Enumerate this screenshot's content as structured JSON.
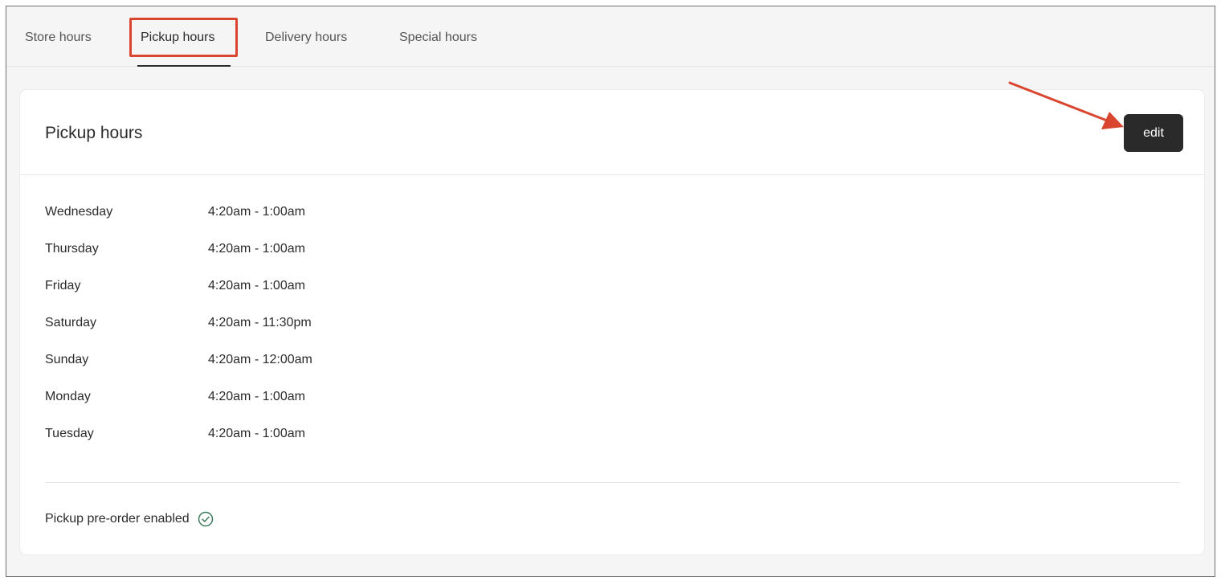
{
  "tabs": [
    {
      "label": "Store hours",
      "active": false
    },
    {
      "label": "Pickup hours",
      "active": true
    },
    {
      "label": "Delivery hours",
      "active": false
    },
    {
      "label": "Special hours",
      "active": false
    }
  ],
  "card": {
    "title": "Pickup hours",
    "edit_label": "edit"
  },
  "hours": [
    {
      "day": "Wednesday",
      "range": "4:20am - 1:00am"
    },
    {
      "day": "Thursday",
      "range": "4:20am - 1:00am"
    },
    {
      "day": "Friday",
      "range": "4:20am - 1:00am"
    },
    {
      "day": "Saturday",
      "range": "4:20am - 11:30pm"
    },
    {
      "day": "Sunday",
      "range": "4:20am - 12:00am"
    },
    {
      "day": "Monday",
      "range": "4:20am - 1:00am"
    },
    {
      "day": "Tuesday",
      "range": "4:20am - 1:00am"
    }
  ],
  "preorder": {
    "label": "Pickup pre-order enabled",
    "icon": "check-circle-icon"
  },
  "colors": {
    "annotation": "#d9452e",
    "button_bg": "#2a2a2a",
    "check": "#3d7a5c"
  }
}
